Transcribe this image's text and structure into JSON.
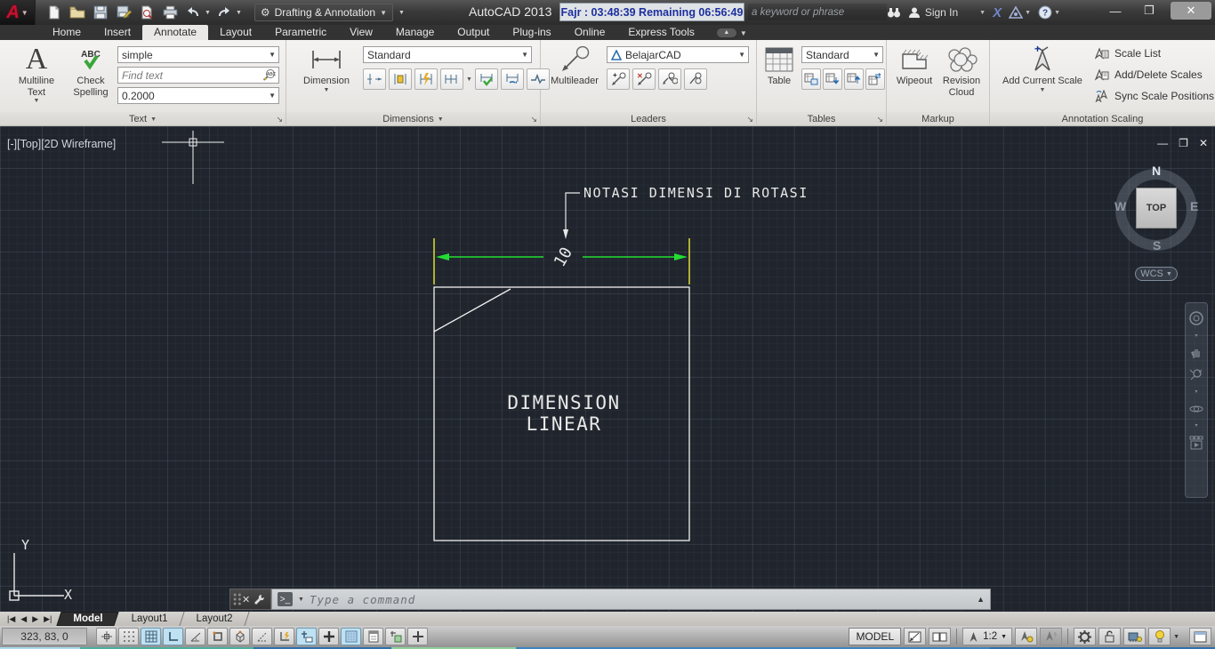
{
  "titlebar": {
    "app_title": "AutoCAD 2013",
    "workspace": "Drafting & Annotation",
    "prayer_timer": "Fajr : 03:48:39 Remaining 06:56:49",
    "search_placeholder": "a keyword or phrase",
    "signin_label": "Sign In"
  },
  "ribbon": {
    "tabs": [
      {
        "label": "Home"
      },
      {
        "label": "Insert"
      },
      {
        "label": "Annotate"
      },
      {
        "label": "Layout"
      },
      {
        "label": "Parametric"
      },
      {
        "label": "View"
      },
      {
        "label": "Manage"
      },
      {
        "label": "Output"
      },
      {
        "label": "Plug-ins"
      },
      {
        "label": "Online"
      },
      {
        "label": "Express Tools"
      }
    ],
    "text_panel": {
      "title": "Text",
      "multiline_text_label": "Multiline Text",
      "check_spelling_label": "Check Spelling",
      "text_style_value": "simple",
      "find_text_placeholder": "Find text",
      "text_height_value": "0.2000"
    },
    "dimensions_panel": {
      "title": "Dimensions",
      "dimension_label": "Dimension",
      "dim_style_value": "Standard"
    },
    "leaders_panel": {
      "title": "Leaders",
      "multileader_label": "Multileader",
      "multileader_style_value": "BelajarCAD"
    },
    "tables_panel": {
      "title": "Tables",
      "table_label": "Table",
      "table_style_value": "Standard"
    },
    "markup_panel": {
      "title": "Markup",
      "wipeout_label": "Wipeout",
      "revision_cloud_label": "Revision Cloud"
    },
    "annotation_scaling_panel": {
      "title": "Annotation Scaling",
      "add_current_scale_label": "Add Current Scale",
      "scale_list_label": "Scale List",
      "add_delete_scales_label": "Add/Delete Scales",
      "sync_scale_positions_label": "Sync Scale Positions"
    }
  },
  "viewport": {
    "label": "[-][Top][2D Wireframe]",
    "viewcube": {
      "north": "N",
      "south": "S",
      "east": "E",
      "west": "W",
      "face": "TOP",
      "wcs": "WCS"
    }
  },
  "drawing": {
    "dimension_value": "10",
    "box_text_line1": "DIMENSION",
    "box_text_line2": "LINEAR",
    "leader_text": "NOTASI DIMENSI DI ROTASI",
    "ucs_x": "X",
    "ucs_y": "Y",
    "colors": {
      "dimension_line": "#22dd33",
      "extension_line": "#e8e838",
      "geometry": "#f2f2f2",
      "background": "#20252d"
    }
  },
  "command_line": {
    "placeholder": "Type a command"
  },
  "layout_tabs": {
    "model": "Model",
    "layout1": "Layout1",
    "layout2": "Layout2"
  },
  "status_bar": {
    "coordinates": "323, 83, 0",
    "model_button": "MODEL",
    "annotation_scale": "1:2"
  }
}
